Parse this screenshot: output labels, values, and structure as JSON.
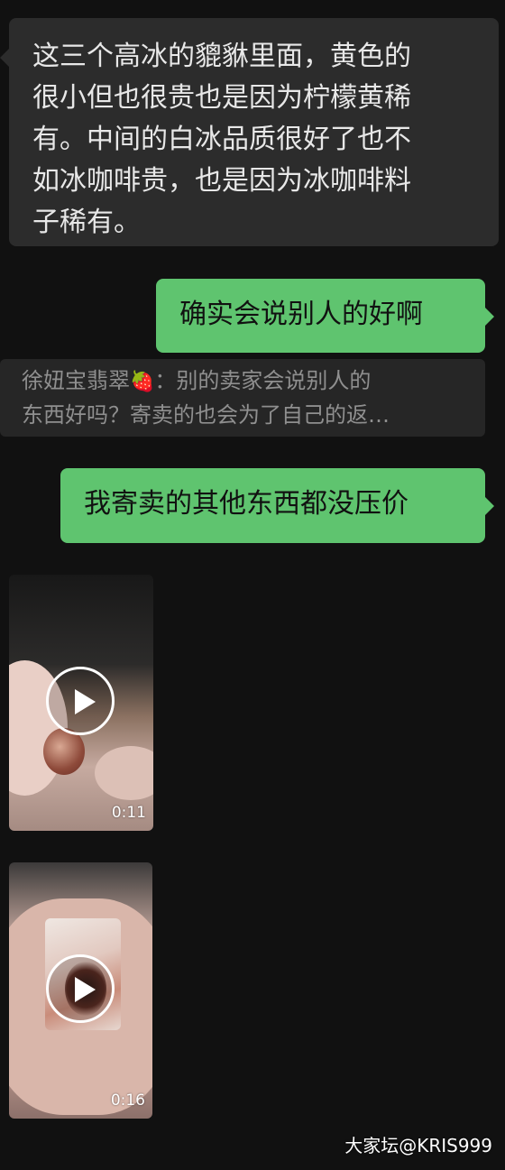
{
  "messages": [
    {
      "direction": "incoming",
      "lines": [
        "这三个高冰的貔貅里面，黄色的",
        "很小但也很贵也是因为柠檬黄稀",
        "有。中间的白冰品质很好了也不",
        "如冰咖啡贵，也是因为冰咖啡料",
        "子稀有。"
      ]
    },
    {
      "direction": "outgoing",
      "text": "确实会说别人的好啊"
    },
    {
      "direction": "outgoing",
      "text": "我寄卖的其他东西都没压价"
    }
  ],
  "quote": {
    "sender": "徐妞宝翡翠",
    "emoji": "🍓",
    "line1_rest": "：别的卖家会说别人的",
    "line2": "东西好吗？寄卖的也会为了自己的返…"
  },
  "videos": [
    {
      "duration": "0:11"
    },
    {
      "duration": "0:16"
    }
  ],
  "watermark": "大家坛@KRIS999",
  "colors": {
    "background": "#111111",
    "incoming_bubble": "#2c2c2c",
    "outgoing_bubble": "#5fc46f",
    "quote_text": "#8f8f8f"
  }
}
